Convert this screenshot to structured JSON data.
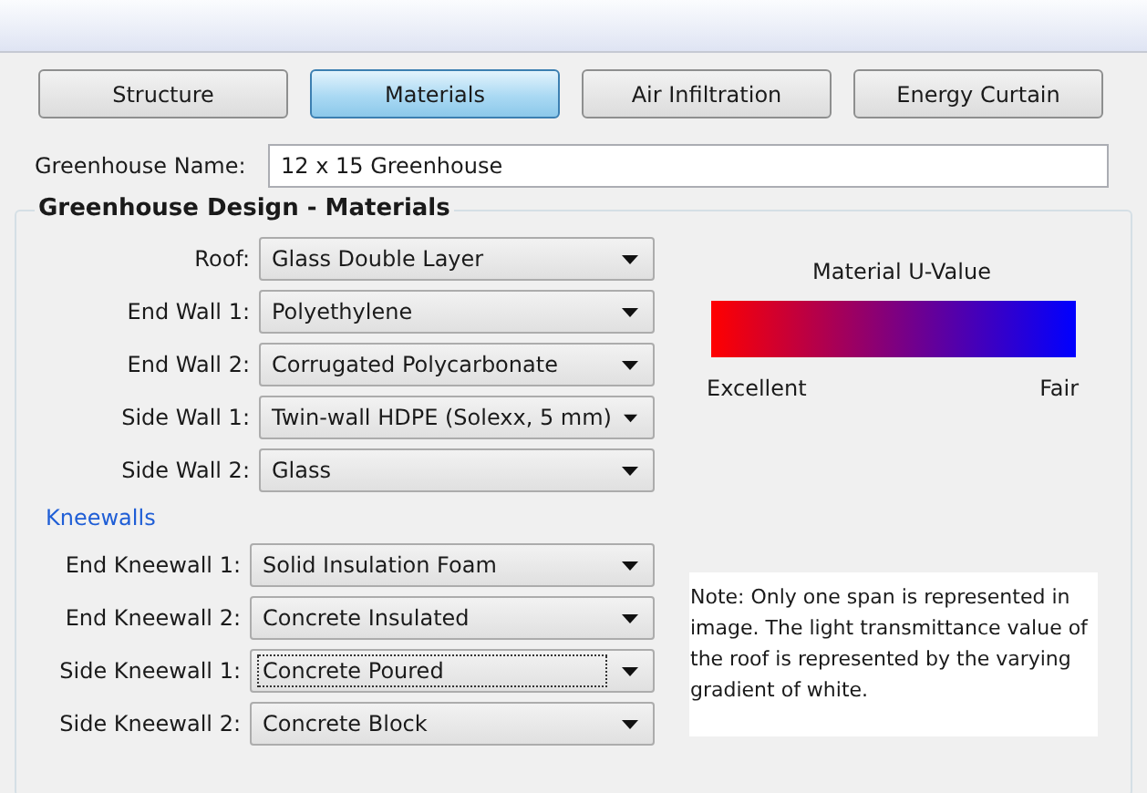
{
  "tabs": [
    {
      "label": "Structure",
      "selected": false
    },
    {
      "label": "Materials",
      "selected": true
    },
    {
      "label": "Air Infiltration",
      "selected": false
    },
    {
      "label": "Energy Curtain",
      "selected": false
    }
  ],
  "greenhouse_name": {
    "label": "Greenhouse Name:",
    "value": "12 x 15 Greenhouse"
  },
  "design_group": {
    "title": "Greenhouse Design - Materials",
    "materials": [
      {
        "label": "Roof:",
        "value": "Glass Double Layer",
        "focused": false
      },
      {
        "label": "End Wall 1:",
        "value": "Polyethylene",
        "focused": false
      },
      {
        "label": "End Wall 2:",
        "value": "Corrugated Polycarbonate",
        "focused": false
      },
      {
        "label": "Side Wall 1:",
        "value": "Twin-wall HDPE (Solexx, 5 mm)",
        "focused": false
      },
      {
        "label": "Side Wall 2:",
        "value": "Glass",
        "focused": false
      }
    ],
    "kneewalls_heading": "Kneewalls",
    "kneewalls": [
      {
        "label": "End Kneewall 1:",
        "value": "Solid Insulation Foam",
        "focused": false
      },
      {
        "label": "End Kneewall 2:",
        "value": "Concrete Insulated",
        "focused": false
      },
      {
        "label": "Side Kneewall 1:",
        "value": "Concrete Poured",
        "focused": true
      },
      {
        "label": "Side Kneewall 2:",
        "value": "Concrete Block",
        "focused": false
      }
    ],
    "legend": {
      "title": "Material U-Value",
      "low_label": "Excellent",
      "high_label": "Fair"
    },
    "note": "Note: Only one span is represented in image. The light transmittance value of the roof is represented by the varying gradient of white."
  }
}
